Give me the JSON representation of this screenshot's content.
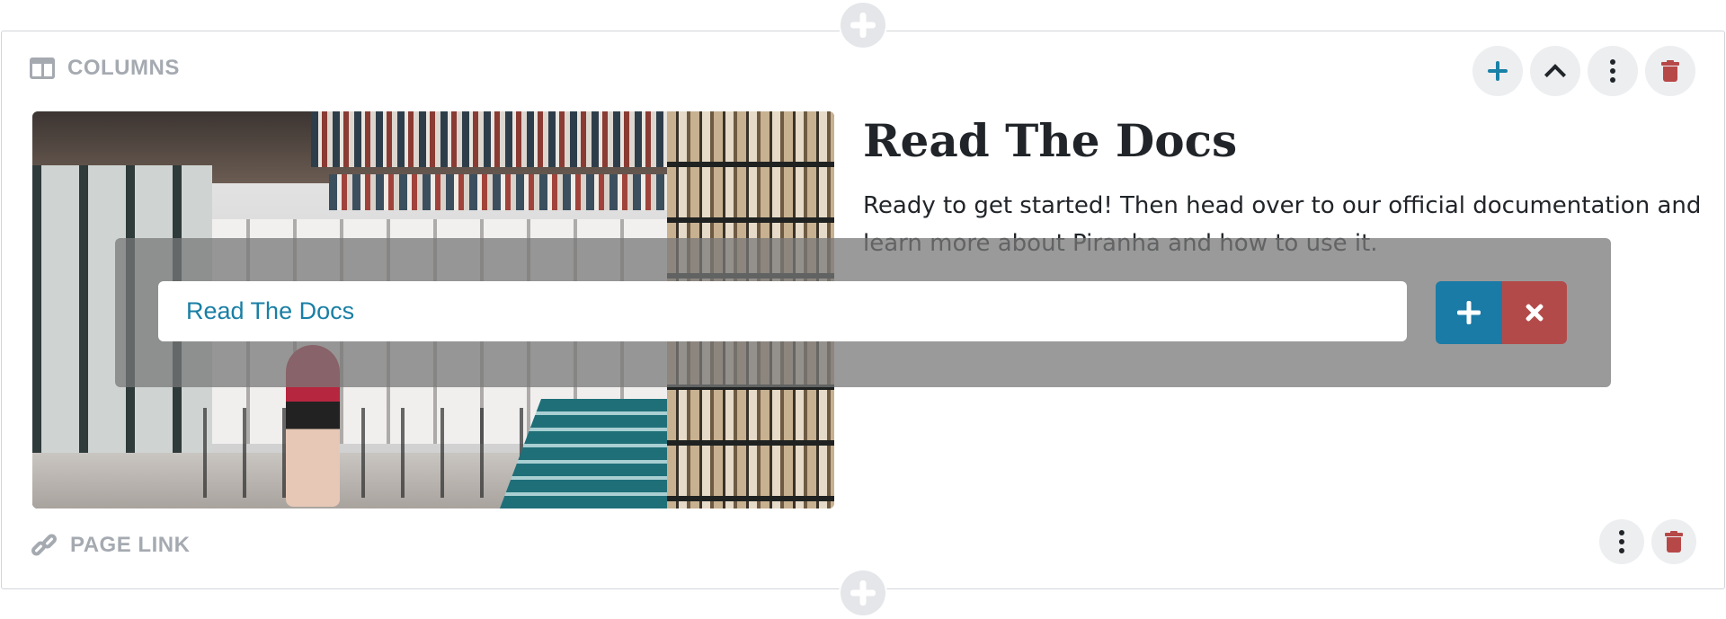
{
  "block": {
    "title": "COLUMNS",
    "tools": {
      "add": "add-block",
      "move_up": "move-up",
      "more": "more-options",
      "delete": "delete-block"
    }
  },
  "content": {
    "heading": "Read The Docs",
    "paragraph": "Ready to get started! Then head over to our official documentation and learn more about Piranha and how to use it."
  },
  "page_link_editor": {
    "value": "Read The Docs"
  },
  "footer_block": {
    "title": "PAGE LINK"
  },
  "colors": {
    "accent_blue": "#1a7ba6",
    "danger_red": "#b34a4a",
    "muted_gray": "#a5aab1"
  }
}
